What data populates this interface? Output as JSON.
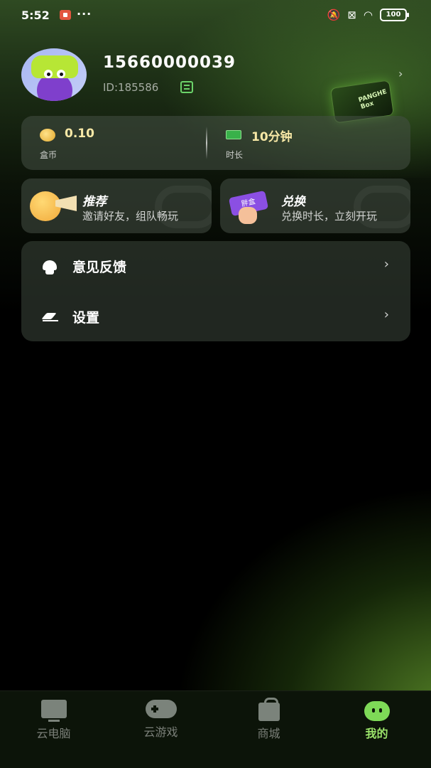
{
  "status_bar": {
    "time": "5:52",
    "dots": "···",
    "battery": "100"
  },
  "profile": {
    "username": "15660000039",
    "user_id": "ID:185586",
    "box_brand": "PANGHE Box"
  },
  "stats": {
    "coins_value": "0.10",
    "coins_label": "盒币",
    "time_value": "10分钟",
    "time_label": "时长"
  },
  "features": {
    "recommend_title": "推荐",
    "recommend_sub": "邀请好友，组队畅玩",
    "exchange_title": "兑换",
    "exchange_sub": "兑换时长，立刻开玩",
    "ticket_text": "胖盒"
  },
  "menu": {
    "feedback_label": "意见反馈",
    "settings_label": "设置",
    "chevron": "›"
  },
  "bottom_nav": {
    "items": [
      {
        "label": "云电脑",
        "icon": "monitor-icon"
      },
      {
        "label": "云游戏",
        "icon": "gamepad-icon"
      },
      {
        "label": "商城",
        "icon": "shopping-bag-icon"
      },
      {
        "label": "我的",
        "icon": "profile-face-icon",
        "active": true
      }
    ]
  },
  "colors": {
    "accent": "#9be36a",
    "coin_text": "#f7e8a6"
  }
}
